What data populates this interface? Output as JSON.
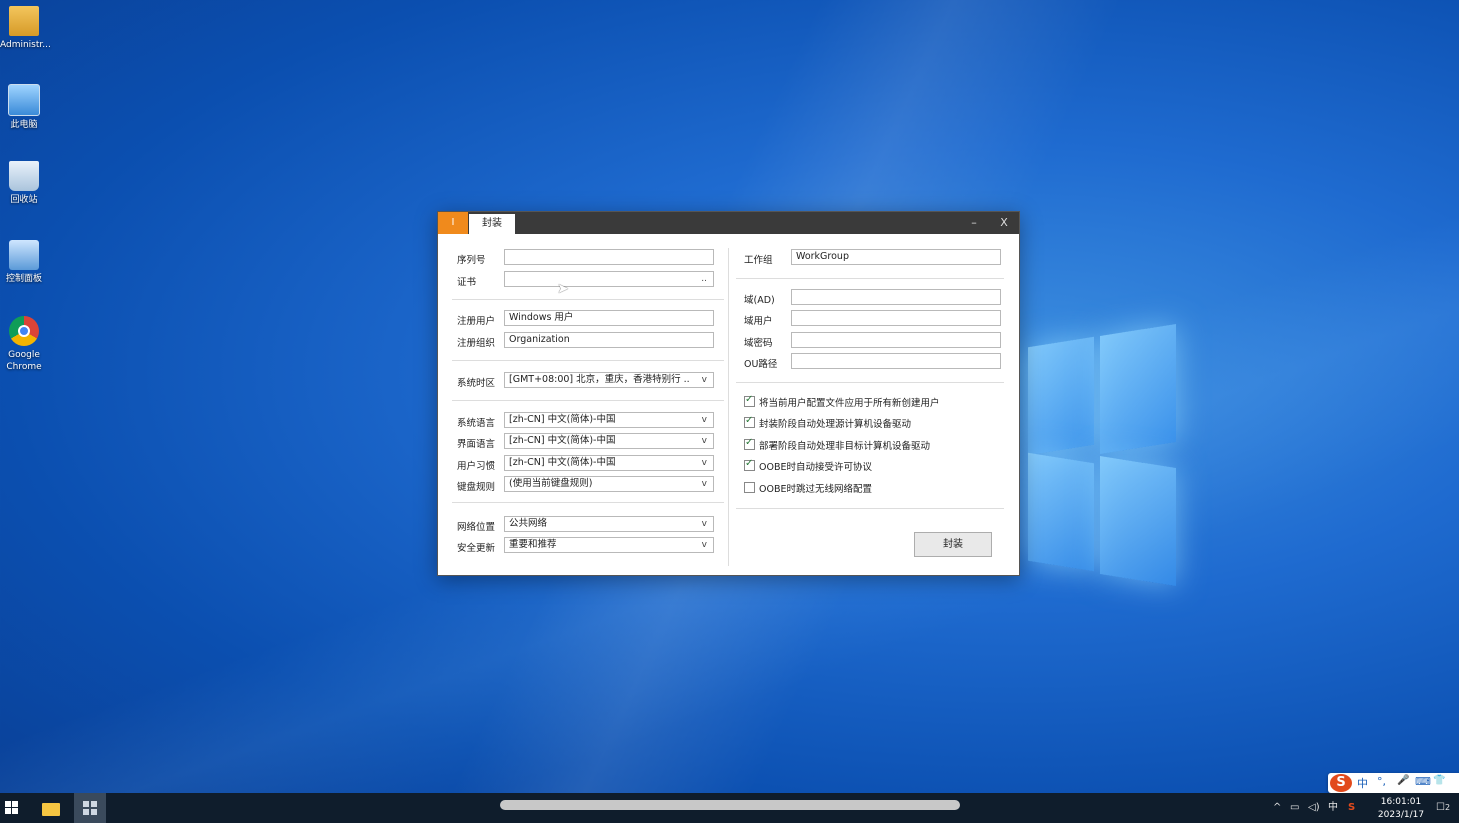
{
  "desktop": {
    "icons": [
      {
        "label": "Administr..."
      },
      {
        "label": "此电脑"
      },
      {
        "label": "回收站"
      },
      {
        "label": "控制面板"
      },
      {
        "label": "Google Chrome"
      }
    ]
  },
  "dialog": {
    "tab_i": "I",
    "tab_active": "封装",
    "minimize": "–",
    "close": "X",
    "left": {
      "serial_label": "序列号",
      "serial_value": "",
      "cert_label": "证书",
      "cert_value": "",
      "cert_browse": "..",
      "reg_user_label": "注册用户",
      "reg_user_value": "Windows 用户",
      "reg_org_label": "注册组织",
      "reg_org_value": "Organization",
      "timezone_label": "系统时区",
      "timezone_value": "[GMT+08:00] 北京，重庆，香港特别行 ..",
      "sys_lang_label": "系统语言",
      "sys_lang_value": "[zh-CN] 中文(简体)-中国",
      "ui_lang_label": "界面语言",
      "ui_lang_value": "[zh-CN] 中文(简体)-中国",
      "user_locale_label": "用户习惯",
      "user_locale_value": "[zh-CN] 中文(简体)-中国",
      "keyboard_label": "键盘规则",
      "keyboard_value": "(使用当前键盘规则)",
      "network_label": "网络位置",
      "network_value": "公共网络",
      "update_label": "安全更新",
      "update_value": "重要和推荐",
      "dropdown_arrow": "v"
    },
    "right": {
      "workgroup_label": "工作组",
      "workgroup_value": "WorkGroup",
      "domain_label": "域(AD)",
      "domain_value": "",
      "domain_user_label": "域用户",
      "domain_user_value": "",
      "domain_pwd_label": "域密码",
      "domain_pwd_value": "",
      "ou_label": "OU路径",
      "ou_value": "",
      "options": [
        {
          "label": "将当前用户配置文件应用于所有新创建用户",
          "checked": true
        },
        {
          "label": "封装阶段自动处理源计算机设备驱动",
          "checked": true
        },
        {
          "label": "部署阶段自动处理非目标计算机设备驱动",
          "checked": true
        },
        {
          "label": "OOBE时自动接受许可协议",
          "checked": true
        },
        {
          "label": "OOBE时跳过无线网络配置",
          "checked": false
        }
      ],
      "seal_button": "封装"
    }
  },
  "ime": {
    "logo": "S",
    "mode": "中",
    "punct": "°,",
    "mic": "🎤",
    "keyboard": "⌨",
    "shirt": "👕"
  },
  "taskbar": {
    "tray_up": "^",
    "tray_lang": "中",
    "time": "16:01:01",
    "date": "2023/1/17",
    "notifications": "2"
  }
}
